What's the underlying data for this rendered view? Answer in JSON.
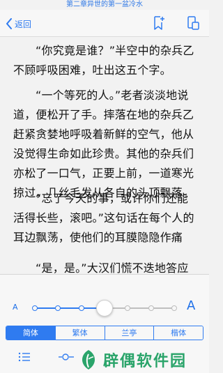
{
  "header": {
    "chapter_title": "第二章异世的第一盆冷水",
    "back_label": "返回"
  },
  "content": {
    "paragraphs": [
      "“你究竟是谁？”半空中的杂兵乙不顾呼吸困难，吐出这五个字。",
      "“一个等死的人。”老者淡淡地说道，便松开了手。摔落在地的杂兵乙赶紧贪婪地呼吸着新鲜的空气，他从没觉得生命如此珍贵。其他的杂兵们亦松了一口气，正要上前，一道寒光掠过，几丝毛发从各自的头顶飘落。",
      "“忘了今天的事，或许你们还能活得长些，滚吧。”这句话在每个人的耳边飘荡，使他们的耳膜隐隐作痛",
      "“是，是。”大汉们慌不迭地答应"
    ]
  },
  "font_size": {
    "small_label": "A",
    "large_label": "A",
    "level": 0.5,
    "steps": 7
  },
  "font_styles": {
    "items": [
      "简体",
      "繁体",
      "兰亭",
      "楷体"
    ],
    "selected": "简体"
  },
  "watermark": {
    "text": "辟偶软件园"
  },
  "colors": {
    "accent": "#2f7bf0",
    "watermark": "#2aa46a"
  }
}
